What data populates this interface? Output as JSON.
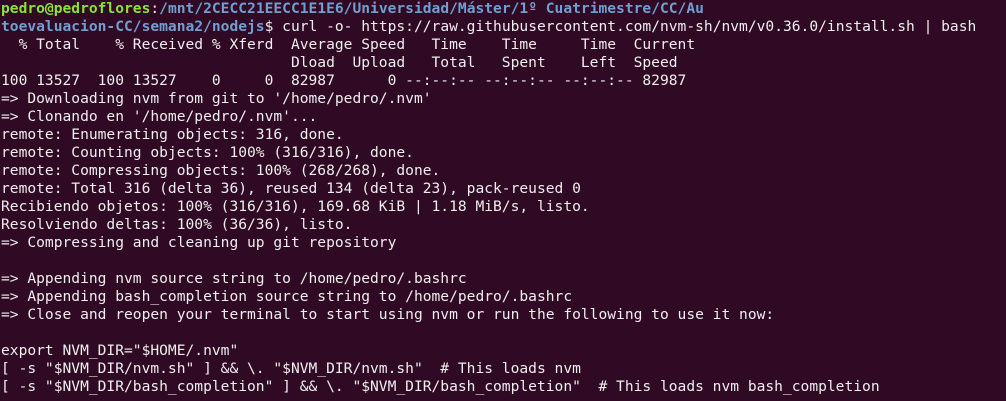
{
  "prompt": {
    "user_host": "pedro@pedroflores",
    "sep": ":",
    "path_part1": "/mnt/2CECC21EECC1E1E6/Universidad/Máster/1º Cuatrimestre/CC/Au",
    "path_part2": "toevaluacion-CC/semana2/nodejs",
    "dollar": "$",
    "command": " curl -o- https://raw.githubusercontent.com/nvm-sh/nvm/v0.36.0/install.sh | bash"
  },
  "output": [
    "  % Total    % Received % Xferd  Average Speed   Time    Time     Time  Current",
    "                                 Dload  Upload   Total   Spent    Left  Speed",
    "100 13527  100 13527    0     0  82987      0 --:--:-- --:--:-- --:--:-- 82987",
    "=> Downloading nvm from git to '/home/pedro/.nvm'",
    "=> Clonando en '/home/pedro/.nvm'...",
    "remote: Enumerating objects: 316, done.",
    "remote: Counting objects: 100% (316/316), done.",
    "remote: Compressing objects: 100% (268/268), done.",
    "remote: Total 316 (delta 36), reused 134 (delta 23), pack-reused 0",
    "Recibiendo objetos: 100% (316/316), 169.68 KiB | 1.18 MiB/s, listo.",
    "Resolviendo deltas: 100% (36/36), listo.",
    "=> Compressing and cleaning up git repository",
    "",
    "=> Appending nvm source string to /home/pedro/.bashrc",
    "=> Appending bash_completion source string to /home/pedro/.bashrc",
    "=> Close and reopen your terminal to start using nvm or run the following to use it now:",
    "",
    "export NVM_DIR=\"$HOME/.nvm\"",
    "[ -s \"$NVM_DIR/nvm.sh\" ] && \\. \"$NVM_DIR/nvm.sh\"  # This loads nvm",
    "[ -s \"$NVM_DIR/bash_completion\" ] && \\. \"$NVM_DIR/bash_completion\"  # This loads nvm bash_completion"
  ]
}
